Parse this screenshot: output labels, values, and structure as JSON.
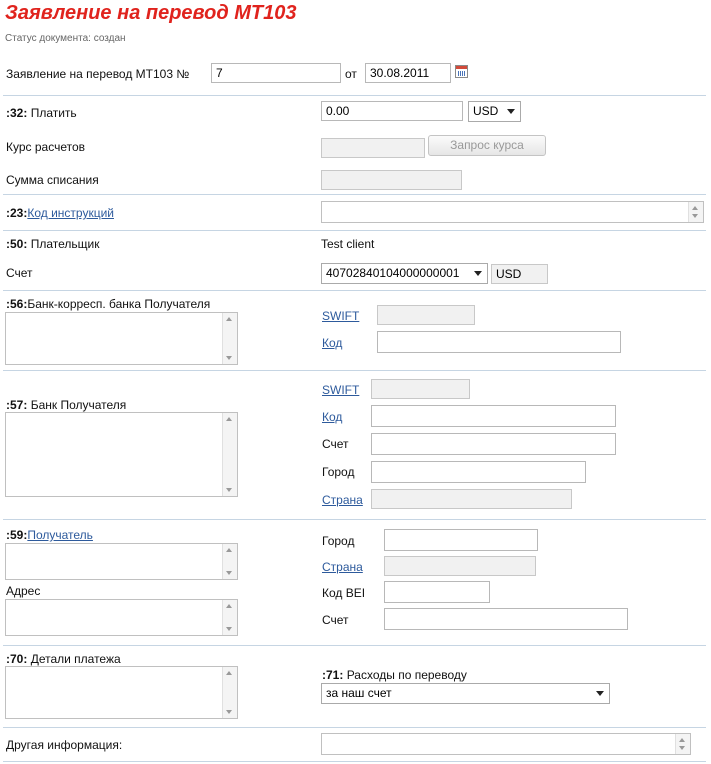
{
  "header": {
    "title": "Заявление на перевод МТ103",
    "status": "Статус документа: создан"
  },
  "doc": {
    "label": "Заявление на перевод МТ103 №",
    "number": "7",
    "date_label": "от",
    "date": "30.08.2011"
  },
  "pay": {
    "code": ":32:",
    "label": "Платить",
    "amount": "0.00",
    "currency": "USD"
  },
  "rate": {
    "label": "Курс расчетов",
    "button": "Запрос курса"
  },
  "debit": {
    "label": "Сумма списания"
  },
  "instr": {
    "code": ":23:",
    "link": "Код инструкций"
  },
  "payer": {
    "code": ":50:",
    "label": "Плательщик",
    "value": "Test client"
  },
  "account": {
    "label": "Счет",
    "number": "40702840104000000001",
    "currency": "USD"
  },
  "corr": {
    "code": ":56:",
    "label": "Банк-корресп. банка Получателя",
    "swift": "SWIFT",
    "kod": "Код"
  },
  "bank": {
    "code": ":57:",
    "label": "Банк Получателя",
    "swift": "SWIFT",
    "kod": "Код",
    "schet": "Счет",
    "gorod": "Город",
    "strana": "Страна"
  },
  "recipient": {
    "code": ":59:",
    "link": "Получатель",
    "address": "Адрес",
    "gorod": "Город",
    "strana": "Страна",
    "bei": "Код BEI",
    "schet": "Счет"
  },
  "details": {
    "code": ":70:",
    "label": "Детали платежа"
  },
  "charges": {
    "code": ":71:",
    "label": "Расходы по переводу",
    "value": "за наш счет"
  },
  "other": {
    "label": "Другая информация:"
  }
}
